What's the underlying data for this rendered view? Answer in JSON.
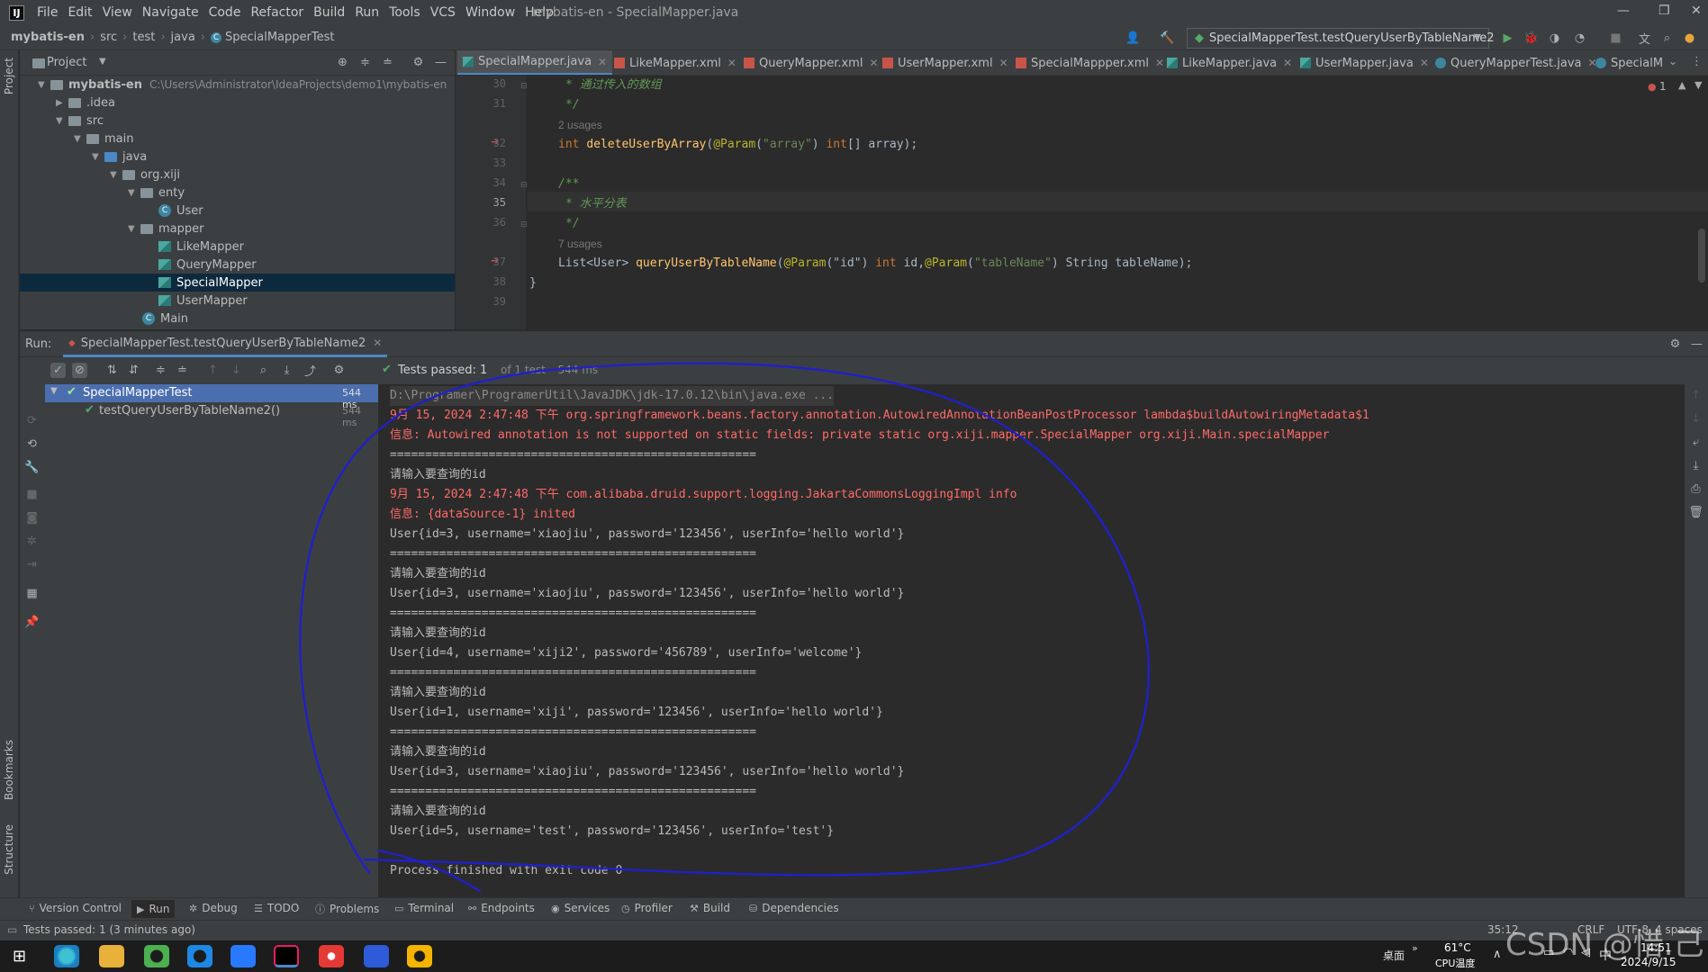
{
  "window": {
    "logo": "IJ",
    "title": "mybatis-en - SpecialMapper.java",
    "menus": [
      "File",
      "Edit",
      "View",
      "Navigate",
      "Code",
      "Refactor",
      "Build",
      "Run",
      "Tools",
      "VCS",
      "Window",
      "Help"
    ]
  },
  "navbar": {
    "breadcrumbs": [
      "mybatis-en",
      "src",
      "test",
      "java",
      "SpecialMapperTest"
    ],
    "run_config": "SpecialMapperTest.testQueryUserByTableName2"
  },
  "project": {
    "header": "Project",
    "root_name": "mybatis-en",
    "root_path": "C:\\Users\\Administrator\\IdeaProjects\\demo1\\mybatis-en",
    "tree": [
      {
        "label": ".idea"
      },
      {
        "label": "src"
      },
      {
        "label": "main"
      },
      {
        "label": "java"
      },
      {
        "label": "org.xiji"
      },
      {
        "label": "enty"
      },
      {
        "label": "User"
      },
      {
        "label": "mapper"
      },
      {
        "label": "LikeMapper"
      },
      {
        "label": "QueryMapper"
      },
      {
        "label": "SpecialMapper"
      },
      {
        "label": "UserMapper"
      },
      {
        "label": "Main"
      }
    ]
  },
  "editor": {
    "tabs": [
      "SpecialMapper.java",
      "LikeMapper.xml",
      "QueryMapper.xml",
      "UserMapper.xml",
      "SpecialMappper.xml",
      "LikeMapper.java",
      "UserMapper.java",
      "QueryMapperTest.java",
      "SpecialM"
    ],
    "error_count": "1",
    "line_numbers": [
      "30",
      "31",
      "32",
      "33",
      "34",
      "35",
      "36",
      "37",
      "38",
      "39"
    ],
    "lines": {
      "l30": "* 通过传入的数组",
      "l31": "*/",
      "u1": "2 usages",
      "l32a": "int ",
      "l32b": "deleteUserByArray",
      "l32c": "(",
      "l32d": "@Param",
      "l32e": "(",
      "l32f": "\"array\"",
      "l32g": ") ",
      "l32h": "int",
      "l32i": "[] array);",
      "l34": "/**",
      "l35": "* 水平分表",
      "l36": "*/",
      "u2": "7 usages",
      "l37a": "List<User> ",
      "l37b": "queryUserByTableName",
      "l37c": "(",
      "l37d": "@Param",
      "l37e": "(\"id\") ",
      "l37f": "int",
      "l37g": " id,",
      "l37h": "@Param",
      "l37i": "(",
      "l37j": "\"tableName\"",
      "l37k": ") String tableName);",
      "l38": "}"
    }
  },
  "run": {
    "label": "Run:",
    "tab": "SpecialMapperTest.testQueryUserByTableName2",
    "status_bold": "Tests passed: 1",
    "status_rest": "of 1 test – 544 ms",
    "tree": [
      {
        "label": "SpecialMapperTest",
        "time": "544 ms"
      },
      {
        "label": "testQueryUserByTableName2()",
        "time": "544 ms"
      }
    ],
    "console": [
      {
        "text": "D:\\Programer\\ProgramerUtil\\JavaJDK\\jdk-17.0.12\\bin\\java.exe ...",
        "style": "gray"
      },
      {
        "text": "9月 15, 2024 2:47:48 下午 org.springframework.beans.factory.annotation.AutowiredAnnotationBeanPostProcessor lambda$buildAutowiringMetadata$1",
        "style": "red"
      },
      {
        "text": "信息: Autowired annotation is not supported on static fields: private static org.xiji.mapper.SpecialMapper org.xiji.Main.specialMapper",
        "style": "red"
      },
      {
        "text": "====================================================",
        "style": "normal"
      },
      {
        "text": "请输入要查询的id",
        "style": "normal"
      },
      {
        "text": "9月 15, 2024 2:47:48 下午 com.alibaba.druid.support.logging.JakartaCommonsLoggingImpl info",
        "style": "red"
      },
      {
        "text": "信息: {dataSource-1} inited",
        "style": "red"
      },
      {
        "text": "User{id=3, username='xiaojiu', password='123456', userInfo='hello world'}",
        "style": "normal"
      },
      {
        "text": "====================================================",
        "style": "normal"
      },
      {
        "text": "请输入要查询的id",
        "style": "normal"
      },
      {
        "text": "User{id=3, username='xiaojiu', password='123456', userInfo='hello world'}",
        "style": "normal"
      },
      {
        "text": "====================================================",
        "style": "normal"
      },
      {
        "text": "请输入要查询的id",
        "style": "normal"
      },
      {
        "text": "User{id=4, username='xiji2', password='456789', userInfo='welcome'}",
        "style": "normal"
      },
      {
        "text": "====================================================",
        "style": "normal"
      },
      {
        "text": "请输入要查询的id",
        "style": "normal"
      },
      {
        "text": "User{id=1, username='xiji', password='123456', userInfo='hello world'}",
        "style": "normal"
      },
      {
        "text": "====================================================",
        "style": "normal"
      },
      {
        "text": "请输入要查询的id",
        "style": "normal"
      },
      {
        "text": "User{id=3, username='xiaojiu', password='123456', userInfo='hello world'}",
        "style": "normal"
      },
      {
        "text": "====================================================",
        "style": "normal"
      },
      {
        "text": "请输入要查询的id",
        "style": "normal"
      },
      {
        "text": "User{id=5, username='test', password='123456', userInfo='test'}",
        "style": "normal"
      },
      {
        "text": "",
        "style": "normal"
      },
      {
        "text": "Process finished with exit code 0",
        "style": "normal"
      }
    ]
  },
  "side_labels": {
    "project": "Project",
    "bookmarks": "Bookmarks",
    "structure": "Structure"
  },
  "tool_windows": [
    "Version Control",
    "Run",
    "Debug",
    "TODO",
    "Problems",
    "Terminal",
    "Endpoints",
    "Services",
    "Profiler",
    "Build",
    "Dependencies"
  ],
  "status": {
    "message": "Tests passed: 1 (3 minutes ago)",
    "position": "35:12",
    "line_sep": "CRLF",
    "encoding": "UTF-8",
    "indent": "4 spaces"
  },
  "taskbar": {
    "desktop": "桌面",
    "temp": "61°C",
    "temp_label": "CPU温度",
    "ime": "中",
    "time": "14:51",
    "date": "2024/9/15"
  },
  "watermark": "CSDN @惜.己",
  "colors": {
    "accent": "#4a88c7",
    "annotation": "#2020c8",
    "console_red": "#ff6b68",
    "pass_green": "#59a869"
  }
}
